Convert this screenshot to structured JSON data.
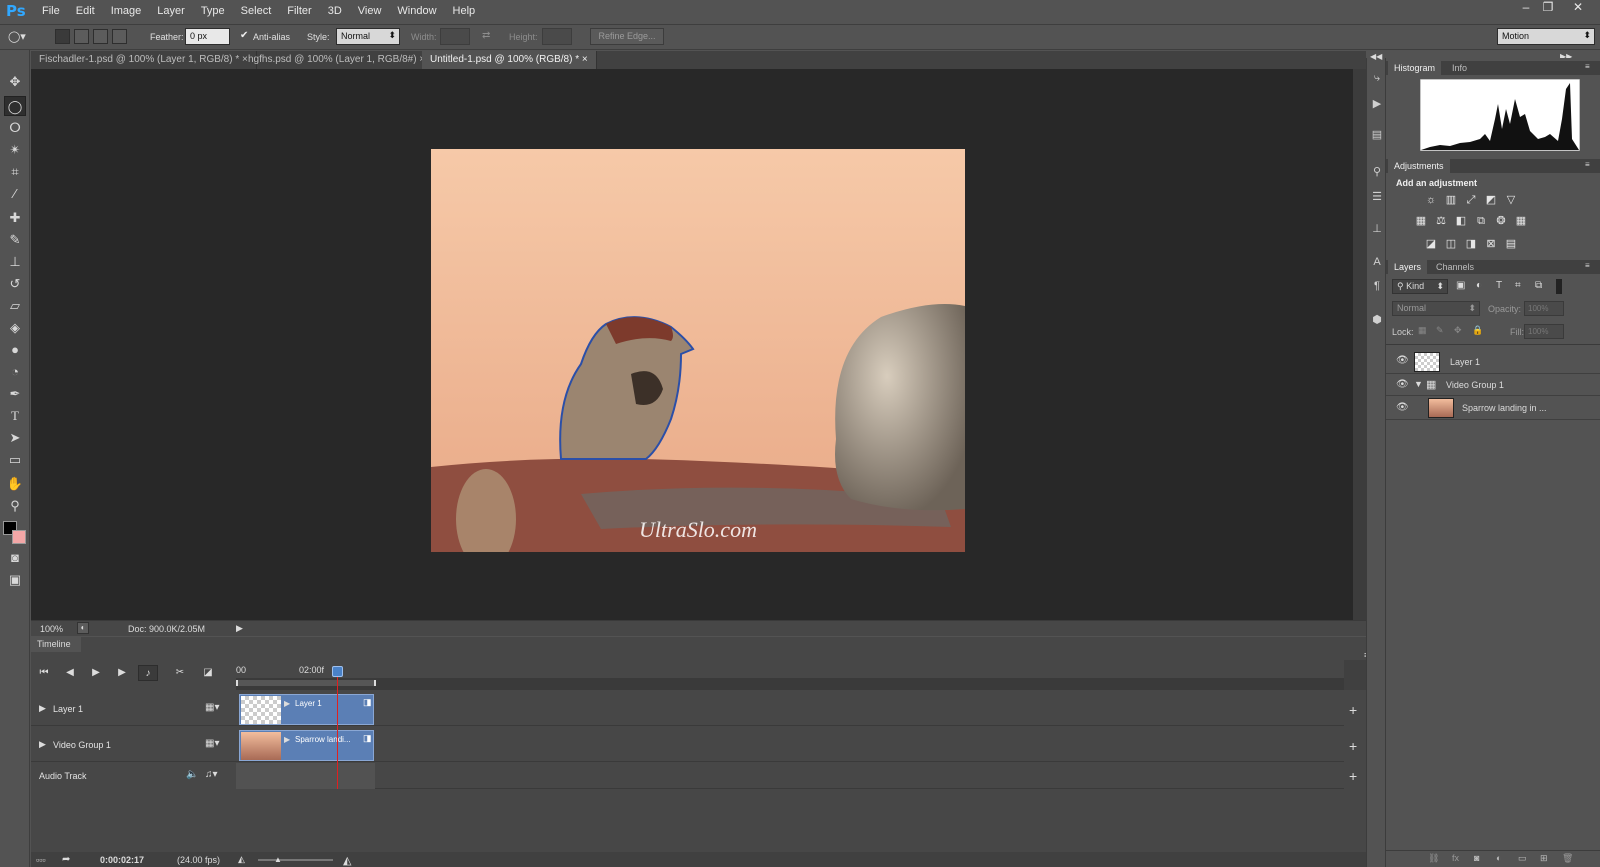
{
  "app": {
    "logo": "Ps"
  },
  "menu": [
    "File",
    "Edit",
    "Image",
    "Layer",
    "Type",
    "Select",
    "Filter",
    "3D",
    "View",
    "Window",
    "Help"
  ],
  "window_controls": {
    "minimize": "–",
    "restore": "❐",
    "close": "✕"
  },
  "options": {
    "feather_label": "Feather:",
    "feather_value": "0 px",
    "antialias_label": "Anti-alias",
    "style_label": "Style:",
    "style_value": "Normal",
    "width_label": "Width:",
    "height_label": "Height:",
    "refine_edge": "Refine Edge...",
    "workspace": "Motion"
  },
  "tabs": [
    {
      "label": "Fischadler-1.psd @ 100% (Layer 1, RGB/8) *",
      "close": "×"
    },
    {
      "label": "hgfhs.psd @ 100% (Layer 1, RGB/8#)",
      "close": "×"
    },
    {
      "label": "Untitled-1.psd @ 100% (RGB/8) *",
      "close": "×"
    }
  ],
  "canvas": {
    "watermark": "UltraSlo.com",
    "colors": {
      "bg_top": "#f6c9a8",
      "bg_bottom": "#e8a886",
      "rock": "#b4a999",
      "roof": "#8f4e40",
      "selection": "#2b4fa8"
    }
  },
  "status": {
    "zoom": "100%",
    "doc": "Doc: 900.0K/2.05M"
  },
  "timeline": {
    "title": "Timeline",
    "ruler_start": "00",
    "ruler_mark": "02:00f",
    "tracks": [
      {
        "label": "Layer 1",
        "clip_label": "Layer 1"
      },
      {
        "label": "Video Group 1",
        "clip_label": "Sparrow landi..."
      },
      {
        "label": "Audio Track"
      }
    ],
    "current_time": "0:00:02:17",
    "fps": "(24.00 fps)",
    "add": "+"
  },
  "panels": {
    "histogram_tab": "Histogram",
    "info_tab": "Info",
    "adjustments_tab": "Adjustments",
    "add_adjustment": "Add an adjustment",
    "layers_tab": "Layers",
    "channels_tab": "Channels",
    "kind": "Kind",
    "blend_mode": "Normal",
    "opacity_label": "Opacity:",
    "opacity_value": "100%",
    "lock_label": "Lock:",
    "fill_label": "Fill:",
    "fill_value": "100%",
    "layers": [
      {
        "name": "Layer 1"
      },
      {
        "name": "Video Group 1"
      },
      {
        "name": "Sparrow landing in ..."
      }
    ]
  }
}
